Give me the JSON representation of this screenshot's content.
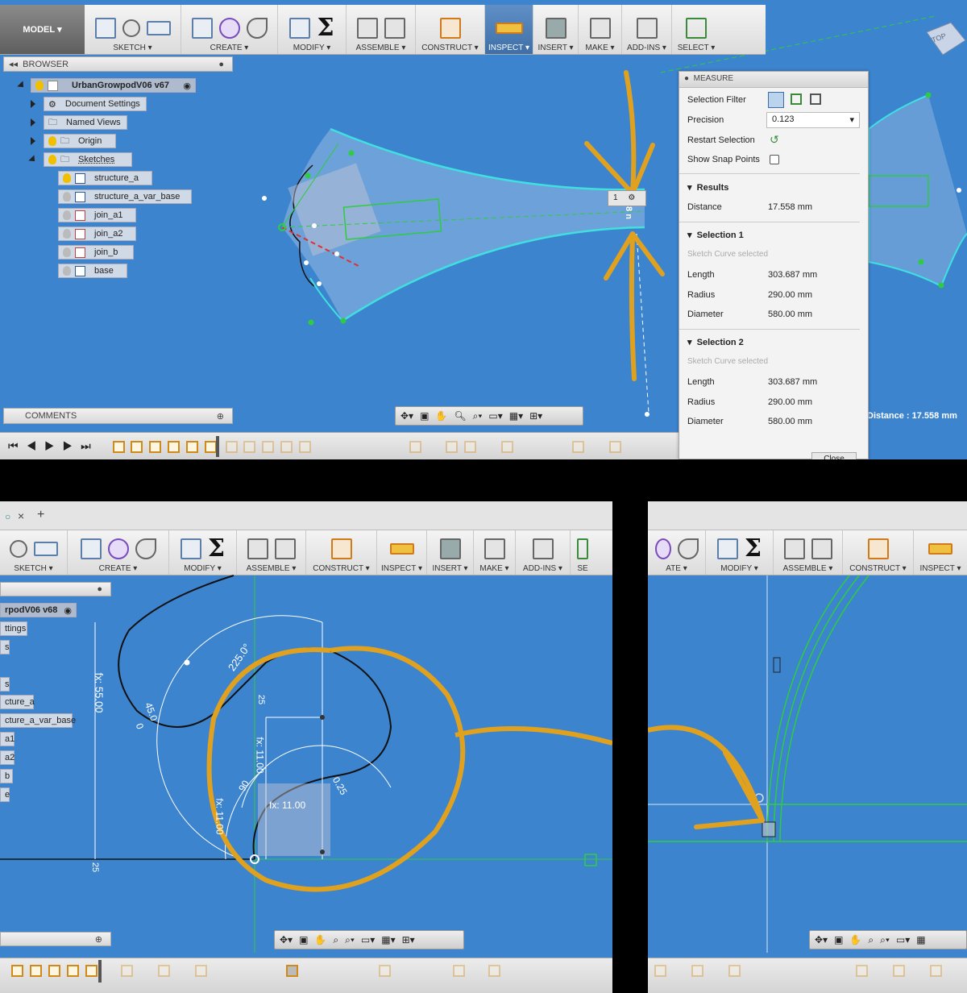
{
  "top": {
    "model_button": "MODEL",
    "toolbar_labels": {
      "sketch": "SKETCH",
      "create": "CREATE",
      "modify": "MODIFY",
      "assemble": "ASSEMBLE",
      "construct": "CONSTRUCT",
      "inspect": "INSPECT",
      "insert": "INSERT",
      "make": "MAKE",
      "addins": "ADD-INS",
      "select": "SELECT"
    },
    "browser": {
      "title": "BROWSER",
      "root": "UrbanGrowpodV06 v67",
      "items": [
        "Document Settings",
        "Named Views",
        "Origin",
        "Sketches"
      ],
      "sketches": [
        "structure_a",
        "structure_a_var_base",
        "join_a1",
        "join_a2",
        "join_b",
        "base"
      ]
    },
    "comments_label": "COMMENTS",
    "measure": {
      "title": "MEASURE",
      "selection_filter_label": "Selection Filter",
      "precision_label": "Precision",
      "precision_value": "0.123",
      "restart_label": "Restart Selection",
      "snap_label": "Show Snap Points",
      "results_label": "Results",
      "distance_label": "Distance",
      "distance_value": "17.558 mm",
      "selection1": {
        "title": "Selection 1",
        "subtitle": "Sketch Curve selected",
        "length_label": "Length",
        "length": "303.687 mm",
        "radius_label": "Radius",
        "radius": "290.00 mm",
        "diameter_label": "Diameter",
        "diameter": "580.00 mm"
      },
      "selection2": {
        "title": "Selection 2",
        "subtitle": "Sketch Curve selected",
        "length_label": "Length",
        "length": "303.687 mm",
        "radius_label": "Radius",
        "radius": "290.00 mm",
        "diameter_label": "Diameter",
        "diameter": "580.00 mm"
      },
      "close_label": "Close"
    },
    "distance_overlay": "Distance : 17.558 mm",
    "view_cube": "TOP",
    "point_badge": "1",
    "dim_label": "8 n"
  },
  "bottom_left": {
    "tab_plus": "+",
    "tab_close": "×",
    "toolbar_labels": {
      "sketch": "SKETCH",
      "create": "CREATE",
      "modify": "MODIFY",
      "assemble": "ASSEMBLE",
      "construct": "CONSTRUCT",
      "inspect": "INSPECT",
      "insert": "INSERT",
      "make": "MAKE",
      "addins": "ADD-INS",
      "se": "SE"
    },
    "browser_root": "rpodV06 v68",
    "browser_items": [
      "ttings",
      "s",
      "s",
      "cture_a",
      "cture_a_var_base",
      "a1",
      "a2",
      "b",
      "e"
    ],
    "dims": {
      "d1": "fx: 55.00",
      "d2": "225.0°",
      "d3": "45.0",
      "d4": "25",
      "d5": "fx: 11.00",
      "d6": "fx: 11.00",
      "d7": "90",
      "d8": "0.25",
      "d9": "fx: 11.00",
      "d10": "25",
      "d11": "0"
    }
  },
  "bottom_right": {
    "toolbar_labels": {
      "ate": "ATE",
      "modify": "MODIFY",
      "assemble": "ASSEMBLE",
      "construct": "CONSTRUCT",
      "inspect": "INSPECT"
    }
  },
  "colors": {
    "canvas": "#3d84cf",
    "annotation": "#e0a21e",
    "sketch_line": "#3fe0e0",
    "constraint_green": "#2ecc40"
  }
}
